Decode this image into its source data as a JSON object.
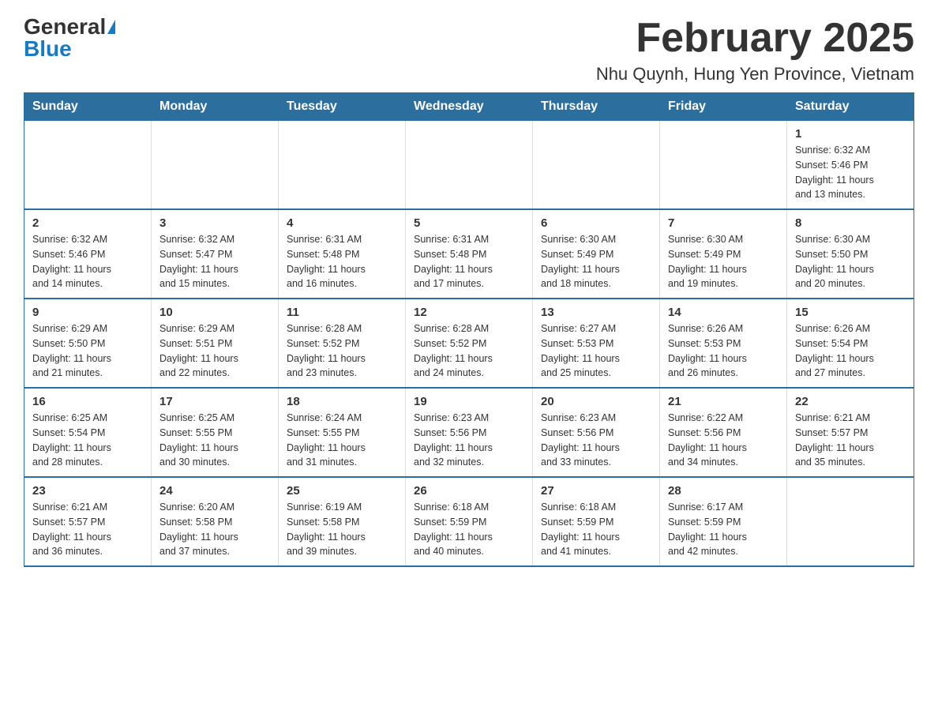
{
  "header": {
    "logo_general": "General",
    "logo_blue": "Blue",
    "month_title": "February 2025",
    "location": "Nhu Quynh, Hung Yen Province, Vietnam"
  },
  "weekdays": [
    "Sunday",
    "Monday",
    "Tuesday",
    "Wednesday",
    "Thursday",
    "Friday",
    "Saturday"
  ],
  "weeks": [
    [
      {
        "day": "",
        "info": ""
      },
      {
        "day": "",
        "info": ""
      },
      {
        "day": "",
        "info": ""
      },
      {
        "day": "",
        "info": ""
      },
      {
        "day": "",
        "info": ""
      },
      {
        "day": "",
        "info": ""
      },
      {
        "day": "1",
        "info": "Sunrise: 6:32 AM\nSunset: 5:46 PM\nDaylight: 11 hours\nand 13 minutes."
      }
    ],
    [
      {
        "day": "2",
        "info": "Sunrise: 6:32 AM\nSunset: 5:46 PM\nDaylight: 11 hours\nand 14 minutes."
      },
      {
        "day": "3",
        "info": "Sunrise: 6:32 AM\nSunset: 5:47 PM\nDaylight: 11 hours\nand 15 minutes."
      },
      {
        "day": "4",
        "info": "Sunrise: 6:31 AM\nSunset: 5:48 PM\nDaylight: 11 hours\nand 16 minutes."
      },
      {
        "day": "5",
        "info": "Sunrise: 6:31 AM\nSunset: 5:48 PM\nDaylight: 11 hours\nand 17 minutes."
      },
      {
        "day": "6",
        "info": "Sunrise: 6:30 AM\nSunset: 5:49 PM\nDaylight: 11 hours\nand 18 minutes."
      },
      {
        "day": "7",
        "info": "Sunrise: 6:30 AM\nSunset: 5:49 PM\nDaylight: 11 hours\nand 19 minutes."
      },
      {
        "day": "8",
        "info": "Sunrise: 6:30 AM\nSunset: 5:50 PM\nDaylight: 11 hours\nand 20 minutes."
      }
    ],
    [
      {
        "day": "9",
        "info": "Sunrise: 6:29 AM\nSunset: 5:50 PM\nDaylight: 11 hours\nand 21 minutes."
      },
      {
        "day": "10",
        "info": "Sunrise: 6:29 AM\nSunset: 5:51 PM\nDaylight: 11 hours\nand 22 minutes."
      },
      {
        "day": "11",
        "info": "Sunrise: 6:28 AM\nSunset: 5:52 PM\nDaylight: 11 hours\nand 23 minutes."
      },
      {
        "day": "12",
        "info": "Sunrise: 6:28 AM\nSunset: 5:52 PM\nDaylight: 11 hours\nand 24 minutes."
      },
      {
        "day": "13",
        "info": "Sunrise: 6:27 AM\nSunset: 5:53 PM\nDaylight: 11 hours\nand 25 minutes."
      },
      {
        "day": "14",
        "info": "Sunrise: 6:26 AM\nSunset: 5:53 PM\nDaylight: 11 hours\nand 26 minutes."
      },
      {
        "day": "15",
        "info": "Sunrise: 6:26 AM\nSunset: 5:54 PM\nDaylight: 11 hours\nand 27 minutes."
      }
    ],
    [
      {
        "day": "16",
        "info": "Sunrise: 6:25 AM\nSunset: 5:54 PM\nDaylight: 11 hours\nand 28 minutes."
      },
      {
        "day": "17",
        "info": "Sunrise: 6:25 AM\nSunset: 5:55 PM\nDaylight: 11 hours\nand 30 minutes."
      },
      {
        "day": "18",
        "info": "Sunrise: 6:24 AM\nSunset: 5:55 PM\nDaylight: 11 hours\nand 31 minutes."
      },
      {
        "day": "19",
        "info": "Sunrise: 6:23 AM\nSunset: 5:56 PM\nDaylight: 11 hours\nand 32 minutes."
      },
      {
        "day": "20",
        "info": "Sunrise: 6:23 AM\nSunset: 5:56 PM\nDaylight: 11 hours\nand 33 minutes."
      },
      {
        "day": "21",
        "info": "Sunrise: 6:22 AM\nSunset: 5:56 PM\nDaylight: 11 hours\nand 34 minutes."
      },
      {
        "day": "22",
        "info": "Sunrise: 6:21 AM\nSunset: 5:57 PM\nDaylight: 11 hours\nand 35 minutes."
      }
    ],
    [
      {
        "day": "23",
        "info": "Sunrise: 6:21 AM\nSunset: 5:57 PM\nDaylight: 11 hours\nand 36 minutes."
      },
      {
        "day": "24",
        "info": "Sunrise: 6:20 AM\nSunset: 5:58 PM\nDaylight: 11 hours\nand 37 minutes."
      },
      {
        "day": "25",
        "info": "Sunrise: 6:19 AM\nSunset: 5:58 PM\nDaylight: 11 hours\nand 39 minutes."
      },
      {
        "day": "26",
        "info": "Sunrise: 6:18 AM\nSunset: 5:59 PM\nDaylight: 11 hours\nand 40 minutes."
      },
      {
        "day": "27",
        "info": "Sunrise: 6:18 AM\nSunset: 5:59 PM\nDaylight: 11 hours\nand 41 minutes."
      },
      {
        "day": "28",
        "info": "Sunrise: 6:17 AM\nSunset: 5:59 PM\nDaylight: 11 hours\nand 42 minutes."
      },
      {
        "day": "",
        "info": ""
      }
    ]
  ]
}
